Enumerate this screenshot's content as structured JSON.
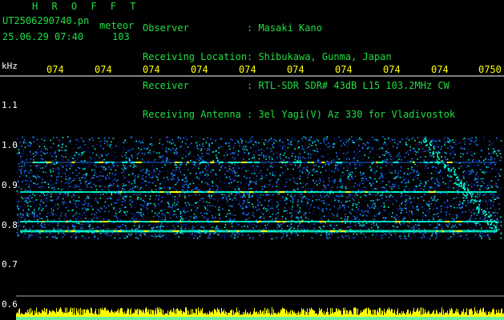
{
  "header": {
    "title": "H R O F F T",
    "filename": "UT2506290740.pn",
    "tag": "meteor",
    "datetime": "25.06.29 07:40",
    "count": "103",
    "fields": [
      {
        "label": "Observer",
        "value": ": Masaki Kano"
      },
      {
        "label": "Receiving Location",
        "value": ": Shibukawa, Gunma, Japan"
      },
      {
        "label": "Receiver",
        "value": ": RTL-SDR SDR# 43dB L15 103.2MHz CW"
      },
      {
        "label": "Receiving Antenna",
        "value": ": 3el Yagi(V) Az 330 for Vladivostok"
      }
    ]
  },
  "axis": {
    "unit": "kHz",
    "y_labels": [
      "1.1",
      "1.0",
      "0.9",
      "0.8",
      "0.7",
      "0.6"
    ],
    "x_ticks": [
      "074",
      "074",
      "074",
      "074",
      "074",
      "074",
      "074",
      "074",
      "074",
      "0750"
    ]
  },
  "colors": {
    "background": "#000000",
    "header_text": "#22dd44",
    "tick_text": "#ffff00",
    "noise_low": "#0a1e8c",
    "noise_mid": "#1e78ff",
    "noise_high": "#00ffd0",
    "signal_peak": "#ffff00",
    "bottom_bar": "#ffff00"
  }
}
